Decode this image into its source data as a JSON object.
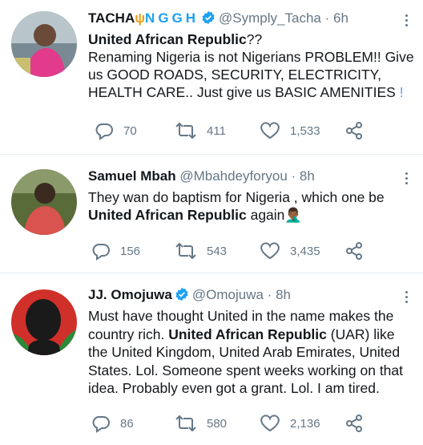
{
  "tweets": [
    {
      "name": "TACHA",
      "name_suffix": "NGGH",
      "handle": "@Symply_Tacha",
      "dot": "·",
      "time": "6h",
      "line1_bold": "United African Republic",
      "line1_rest": "??",
      "line2": " Renaming Nigeria is not Nigerians PROBLEM!! Give us GOOD ROADS, SECURITY, ELECTRICITY, HEALTH CARE.. Just give us BASIC AMENITIES",
      "replies": "70",
      "retweets": "411",
      "likes": "1,533"
    },
    {
      "name": "Samuel Mbah",
      "handle": "@Mbahdeyforyou",
      "dot": "·",
      "time": "8h",
      "line1": "They wan do baptism for Nigeria , which one be",
      "line2_bold": "United African Republic",
      "line2_rest": " again🤦🏾‍♂",
      "replies": "156",
      "retweets": "543",
      "likes": "3,435"
    },
    {
      "name": "JJ. Omojuwa",
      "handle": "@Omojuwa",
      "dot": "·",
      "time": "8h",
      "text_a": "Must have thought United in the name makes the country rich. ",
      "text_bold": "United African Republic",
      "text_b": " (UAR) like the United Kingdom, United Arab Emirates, United States. Lol. Someone spent weeks working on that idea. Probably even got a grant. Lol. I am tired.",
      "replies": "86",
      "retweets": "580",
      "likes": "2,136"
    }
  ],
  "colors": {
    "verified": "#1da1f2",
    "muted": "#657786",
    "accent_gold": "#e8a317",
    "accent_blue": "#1da1f2"
  }
}
